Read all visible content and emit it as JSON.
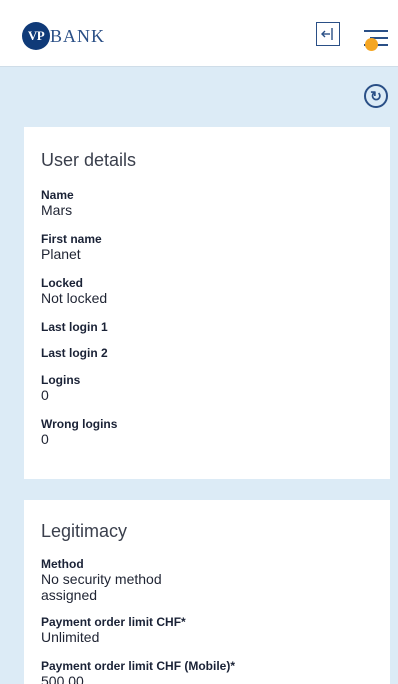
{
  "header": {
    "logo_mark": "VP",
    "logo_text": "BANK",
    "logout_icon": "logout-icon",
    "menu_icon": "hamburger-menu-icon",
    "notification_color": "#f5a623",
    "brand_color": "#0f3a78"
  },
  "toolbar": {
    "refresh_icon": "refresh-icon",
    "refresh_glyph": "↻"
  },
  "user_details": {
    "title": "User details",
    "fields": [
      {
        "label": "Name",
        "value": "Mars"
      },
      {
        "label": "First name",
        "value": "Planet"
      },
      {
        "label": "Locked",
        "value": "Not locked"
      },
      {
        "label": "Last login 1",
        "value": ""
      },
      {
        "label": "Last login 2",
        "value": ""
      },
      {
        "label": "Logins",
        "value": "0"
      },
      {
        "label": "Wrong logins",
        "value": "0"
      }
    ]
  },
  "legitimacy": {
    "title": "Legitimacy",
    "fields": [
      {
        "label": "Method",
        "value_line1": "No security method",
        "value_line2": "assigned"
      },
      {
        "label": "Payment order limit CHF*",
        "value": "Unlimited"
      },
      {
        "label": "Payment order limit CHF (Mobile)*",
        "value": "500.00"
      }
    ]
  }
}
